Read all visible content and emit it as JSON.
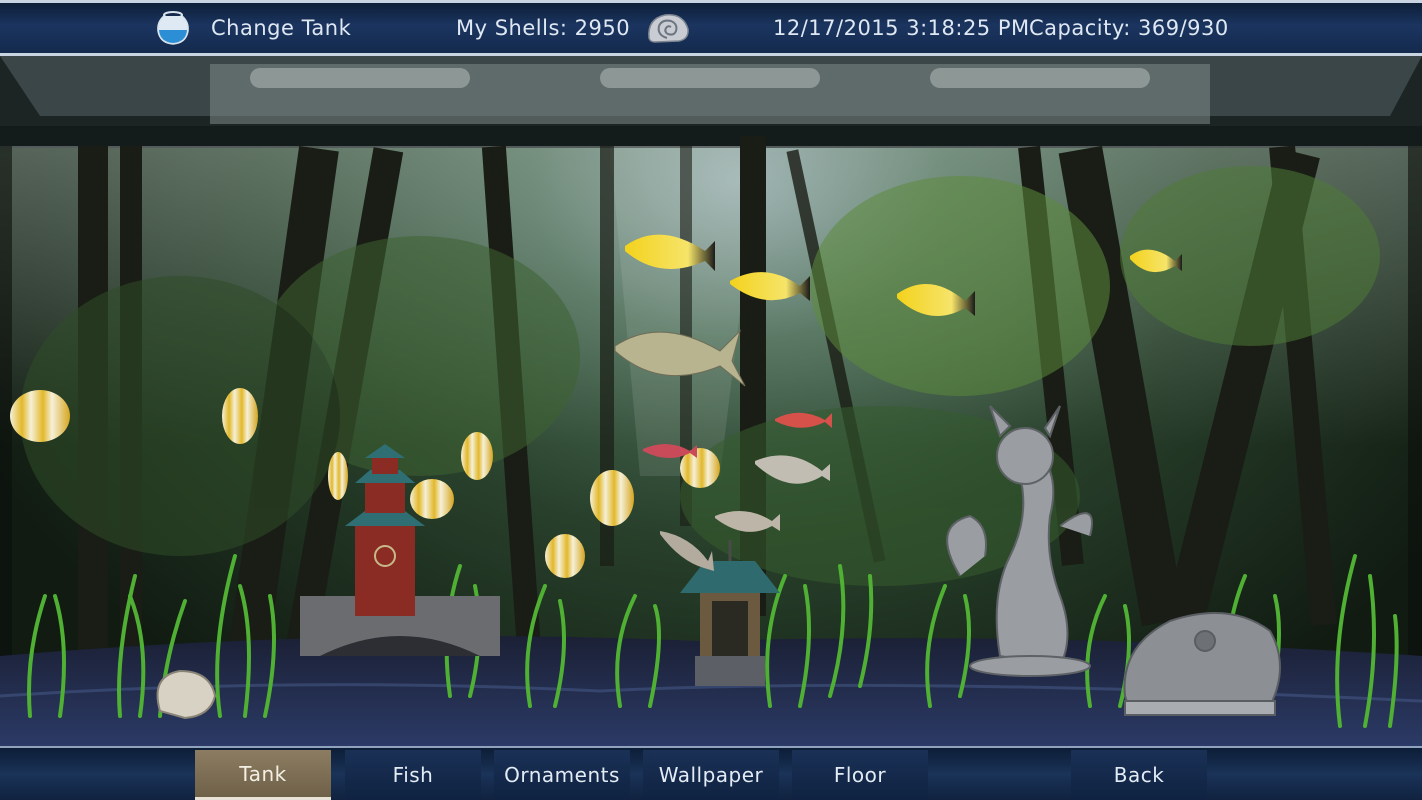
{
  "header": {
    "change_tank_label": "Change Tank",
    "shells_label": "My Shells: 2950",
    "datetime": "12/17/2015 3:18:25 PM",
    "capacity": "Capacity: 369/930",
    "bowl_icon": "fishbowl-icon",
    "shell_icon": "seashell-icon"
  },
  "tabs": [
    {
      "label": "Tank",
      "active": true
    },
    {
      "label": "Fish",
      "active": false
    },
    {
      "label": "Ornaments",
      "active": false
    },
    {
      "label": "Wallpaper",
      "active": false
    },
    {
      "label": "Floor",
      "active": false
    },
    {
      "label": "Back",
      "active": false
    }
  ],
  "colors": {
    "bar": "#1b3560",
    "active_tab": "#8c7d62",
    "text": "#dfe8f2"
  }
}
